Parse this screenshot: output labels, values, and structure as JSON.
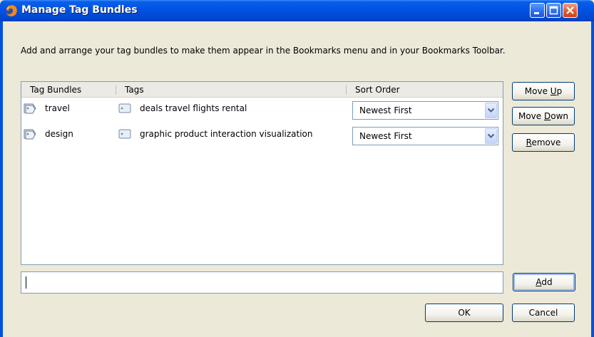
{
  "window": {
    "title": "Manage Tag Bundles",
    "icon": "firefox-icon"
  },
  "description": "Add and arrange your tag bundles to make them appear in the Bookmarks menu and in your Bookmarks Toolbar.",
  "columns": {
    "bundles": "Tag Bundles",
    "tags": "Tags",
    "sort": "Sort Order"
  },
  "rows": [
    {
      "bundle": "travel",
      "tags": "deals travel flights rental",
      "sort": "Newest First"
    },
    {
      "bundle": "design",
      "tags": "graphic product interaction visualization",
      "sort": "Newest First"
    }
  ],
  "buttons": {
    "move_up_pre": "Move ",
    "move_up_key": "U",
    "move_up_post": "p",
    "move_down_pre": "Move ",
    "move_down_key": "D",
    "move_down_post": "own",
    "remove_key": "R",
    "remove_post": "emove",
    "add_key": "A",
    "add_post": "dd",
    "ok": "OK",
    "cancel": "Cancel"
  },
  "new_bundle_input": {
    "value": ""
  }
}
